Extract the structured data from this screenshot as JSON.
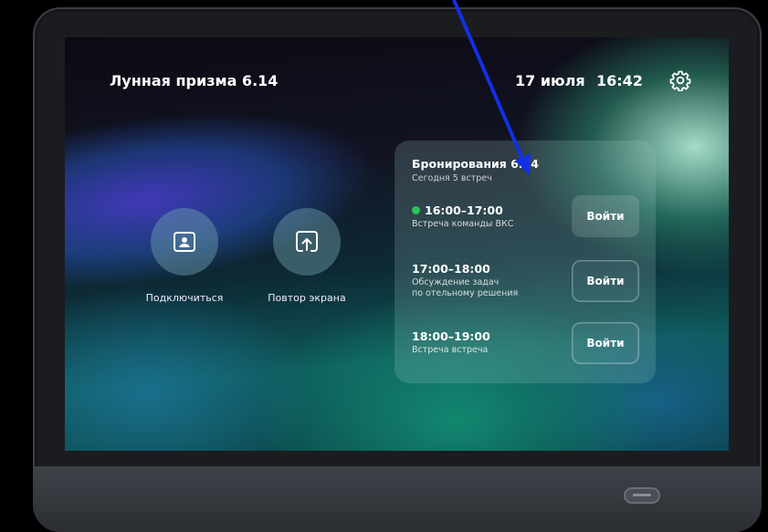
{
  "header": {
    "device_name": "Лунная призма 6.14",
    "date": "17 июля",
    "time": "16:42",
    "settings_icon": "gear-icon"
  },
  "actions": [
    {
      "label": "Подключиться",
      "icon": "contact-card-icon"
    },
    {
      "label": "Повтор экрана",
      "icon": "screen-share-icon"
    }
  ],
  "bookings": {
    "title": "Бронирования 6.14",
    "subtitle": "Сегодня 5 встреч",
    "items": [
      {
        "time": "16:00–17:00",
        "description": "Встреча команды ВКС",
        "active": true,
        "button": "Войти"
      },
      {
        "time": "17:00–18:00",
        "description": "Обсуждение задач\nпо отельному решения",
        "active": false,
        "button": "Войти"
      },
      {
        "time": "18:00–19:00",
        "description": "Встреча встреча",
        "active": false,
        "button": "Войти"
      }
    ]
  },
  "colors": {
    "active_dot": "#2ec25c",
    "annotation_arrow": "#1230e6"
  }
}
